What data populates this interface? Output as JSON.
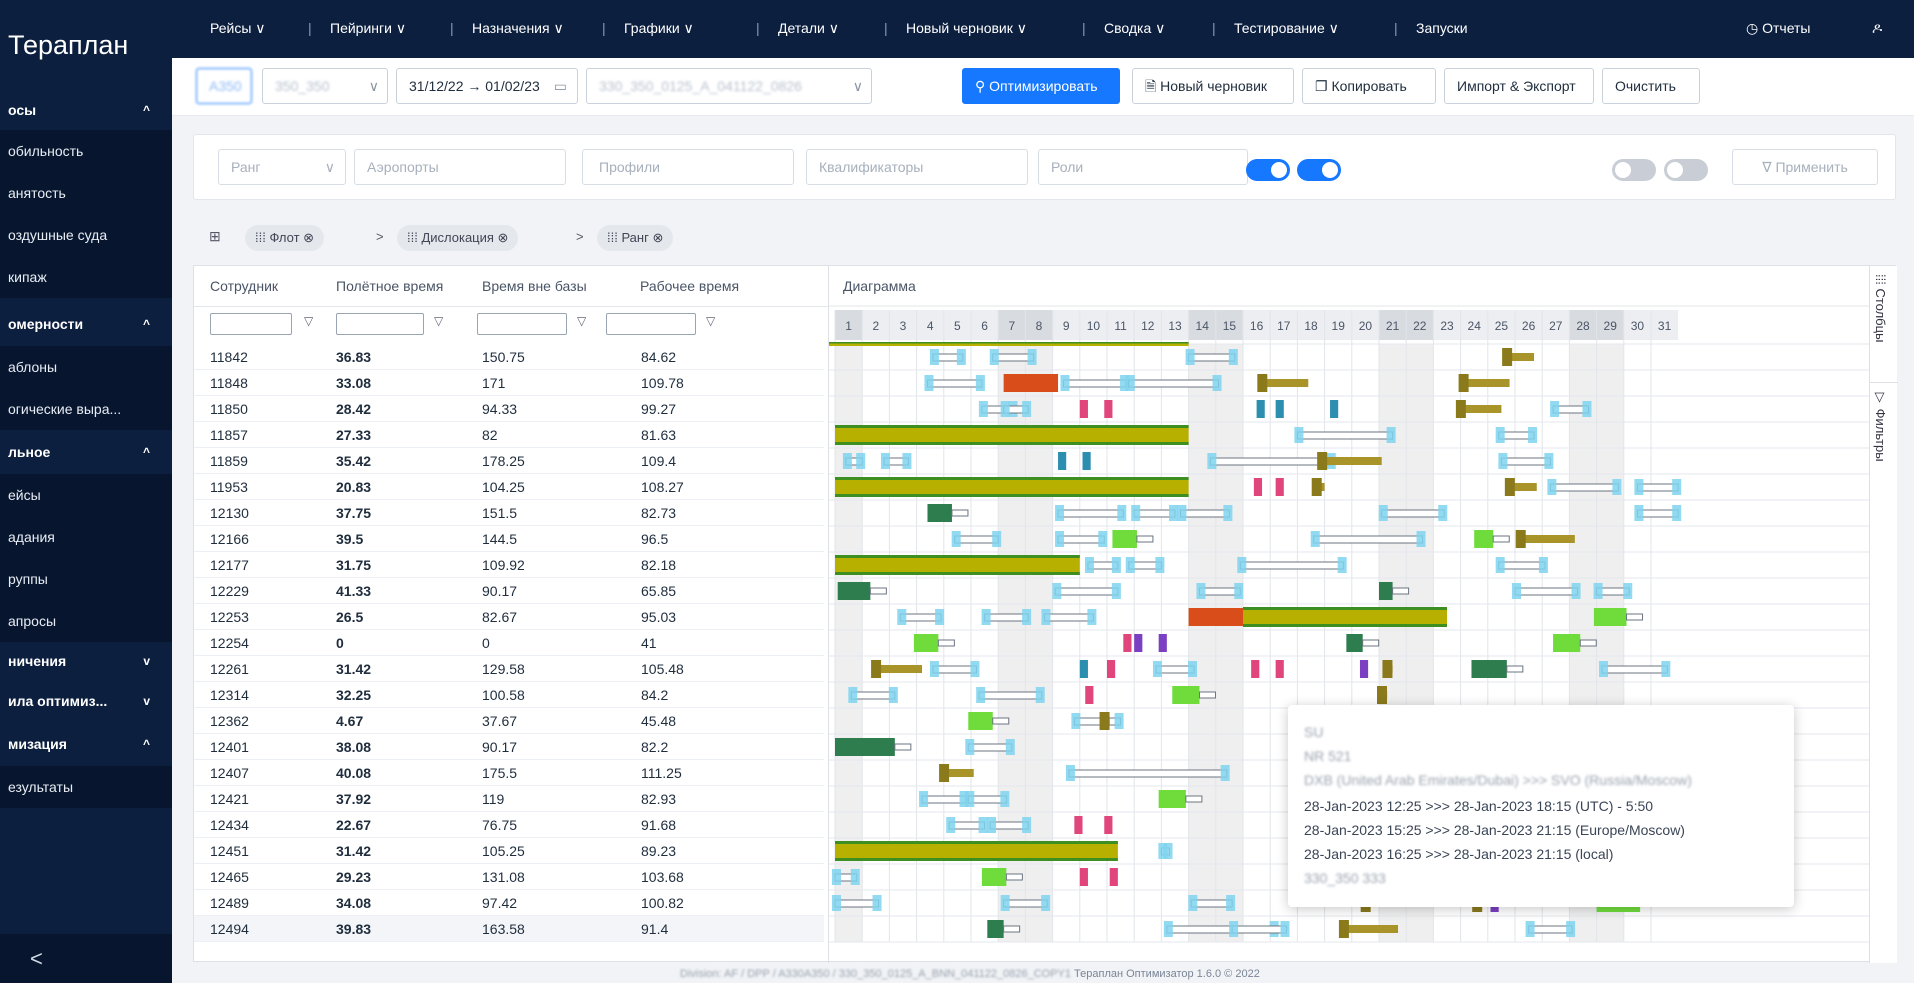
{
  "app": {
    "title": "Терaплан"
  },
  "sidebar": {
    "sections": [
      {
        "label": "осы",
        "chev": "^"
      },
      {
        "label": "омерности",
        "chev": "^"
      },
      {
        "label": "льное",
        "chev": "^"
      },
      {
        "label": "ничения",
        "chev": "v"
      },
      {
        "label": "ила оптимиз...",
        "chev": "v"
      },
      {
        "label": "мизация",
        "chev": "^"
      }
    ],
    "items": [
      "обильность",
      "анятость",
      "оздушные суда",
      "кипаж",
      "аблоны",
      "огические выра...",
      "ейсы",
      "адания",
      "руппы",
      "апросы",
      "езультаты"
    ],
    "collapse": "<"
  },
  "topnav": {
    "items": [
      "Рейсы ∨",
      "Пейринги ∨",
      "Назначения ∨",
      "Графики ∨",
      "Детали ∨",
      "Новый черновик ∨",
      "Сводка ∨",
      "Тестирование ∨",
      "Запуски"
    ],
    "reports": "◷ Отчеты",
    "user": "ዶ"
  },
  "toolbar": {
    "fleet": "A350",
    "subfleet": "350_350",
    "subfleet_chev": "∨",
    "date_range": "31/12/22  →  01/02/23",
    "date_icon": "▭",
    "scenario": "330_350_0125_A_041122_0826",
    "scenario_chev": "∨",
    "optimize": "⚲ Оптимизировать",
    "new_draft": "🗎 Новый черновик",
    "copy": "❐ Копировать",
    "import_export": "Импорт & Экспорт",
    "clear": "Очистить"
  },
  "filters": {
    "rank": "Ранг",
    "rank_chev": "∨",
    "airports": "Аэропорты",
    "profiles": "Профили",
    "qualifiers": "Квалификаторы",
    "roles": "Роли",
    "apply": "∇ Применить"
  },
  "groupbar": {
    "table_icon": "⊞",
    "chips": [
      {
        "label": "⁞⁞⁞  Флот ⊗"
      },
      {
        "label": "⁞⁞⁞  Дислокация ⊗"
      },
      {
        "label": "⁞⁞⁞  Ранг ⊗"
      }
    ],
    "arrow": ">"
  },
  "table": {
    "headers": [
      "Сотрудник",
      "Полётное время",
      "Время вне базы",
      "Рабочее время"
    ],
    "gantt_header": "Диаграмма",
    "filter_icon": "▽",
    "rows": [
      {
        "id": "11842",
        "flight": "36.83",
        "away": "150.75",
        "work": "84.62"
      },
      {
        "id": "11848",
        "flight": "33.08",
        "away": "171",
        "work": "109.78"
      },
      {
        "id": "11850",
        "flight": "28.42",
        "away": "94.33",
        "work": "99.27"
      },
      {
        "id": "11857",
        "flight": "27.33",
        "away": "82",
        "work": "81.63"
      },
      {
        "id": "11859",
        "flight": "35.42",
        "away": "178.25",
        "work": "109.4"
      },
      {
        "id": "11953",
        "flight": "20.83",
        "away": "104.25",
        "work": "108.27"
      },
      {
        "id": "12130",
        "flight": "37.75",
        "away": "151.5",
        "work": "82.73"
      },
      {
        "id": "12166",
        "flight": "39.5",
        "away": "144.5",
        "work": "96.5"
      },
      {
        "id": "12177",
        "flight": "31.75",
        "away": "109.92",
        "work": "82.18"
      },
      {
        "id": "12229",
        "flight": "41.33",
        "away": "90.17",
        "work": "65.85"
      },
      {
        "id": "12253",
        "flight": "26.5",
        "away": "82.67",
        "work": "95.03"
      },
      {
        "id": "12254",
        "flight": "0",
        "away": "0",
        "work": "41"
      },
      {
        "id": "12261",
        "flight": "31.42",
        "away": "129.58",
        "work": "105.48"
      },
      {
        "id": "12314",
        "flight": "32.25",
        "away": "100.58",
        "work": "84.2"
      },
      {
        "id": "12362",
        "flight": "4.67",
        "away": "37.67",
        "work": "45.48"
      },
      {
        "id": "12401",
        "flight": "38.08",
        "away": "90.17",
        "work": "82.2"
      },
      {
        "id": "12407",
        "flight": "40.08",
        "away": "175.5",
        "work": "111.25"
      },
      {
        "id": "12421",
        "flight": "37.92",
        "away": "119",
        "work": "82.93"
      },
      {
        "id": "12434",
        "flight": "22.67",
        "away": "76.75",
        "work": "91.68"
      },
      {
        "id": "12451",
        "flight": "31.42",
        "away": "105.25",
        "work": "89.23"
      },
      {
        "id": "12465",
        "flight": "29.23",
        "away": "131.08",
        "work": "103.68"
      },
      {
        "id": "12489",
        "flight": "34.08",
        "away": "97.42",
        "work": "100.82"
      },
      {
        "id": "12494",
        "flight": "39.83",
        "away": "163.58",
        "work": "91.4"
      }
    ],
    "days": [
      "1",
      "2",
      "3",
      "4",
      "5",
      "6",
      "7",
      "8",
      "9",
      "10",
      "11",
      "12",
      "13",
      "14",
      "15",
      "16",
      "17",
      "18",
      "19",
      "20",
      "21",
      "22",
      "23",
      "24",
      "25",
      "26",
      "27",
      "28",
      "29",
      "30",
      "31"
    ],
    "weekend_days": [
      1,
      7,
      8,
      14,
      15,
      21,
      22,
      28,
      29
    ]
  },
  "rightrail": {
    "columns": "⁞⁞⁞  Столбцы",
    "filters": "▽  Фильтры"
  },
  "tooltip": {
    "line1": "SU",
    "line2": "NR 521",
    "line3": "DXB (United Arab Emirates/Dubai) >>> SVO (Russia/Moscow)",
    "line4": "28-Jan-2023 12:25 >>> 28-Jan-2023 18:15 (UTC) - 5:50",
    "line5": "28-Jan-2023 15:25 >>> 28-Jan-2023 21:15 (Europe/Moscow)",
    "line6": "28-Jan-2023 16:25 >>> 28-Jan-2023 21:15 (local)",
    "line7": "330_350 333"
  },
  "footer": {
    "left": "Division: AF / DPP / A330A350 / 330_350_0125_A_BNN_041122_0826_COPY1",
    "right": "Терaплан Оптимизатор 1.6.0 © 2022"
  },
  "colors": {
    "nav": "#0c1f3f",
    "primary": "#1677ff",
    "reserve_bar": "#b8b000",
    "standby_bar": "#d94d1a",
    "duty_marker": "#7fd3ef",
    "flight_marker": "#3cb31e",
    "dark_green": "#2e7d4f",
    "olive": "#8a7a1c",
    "pink": "#e0457b",
    "purple": "#7b3fc2"
  }
}
